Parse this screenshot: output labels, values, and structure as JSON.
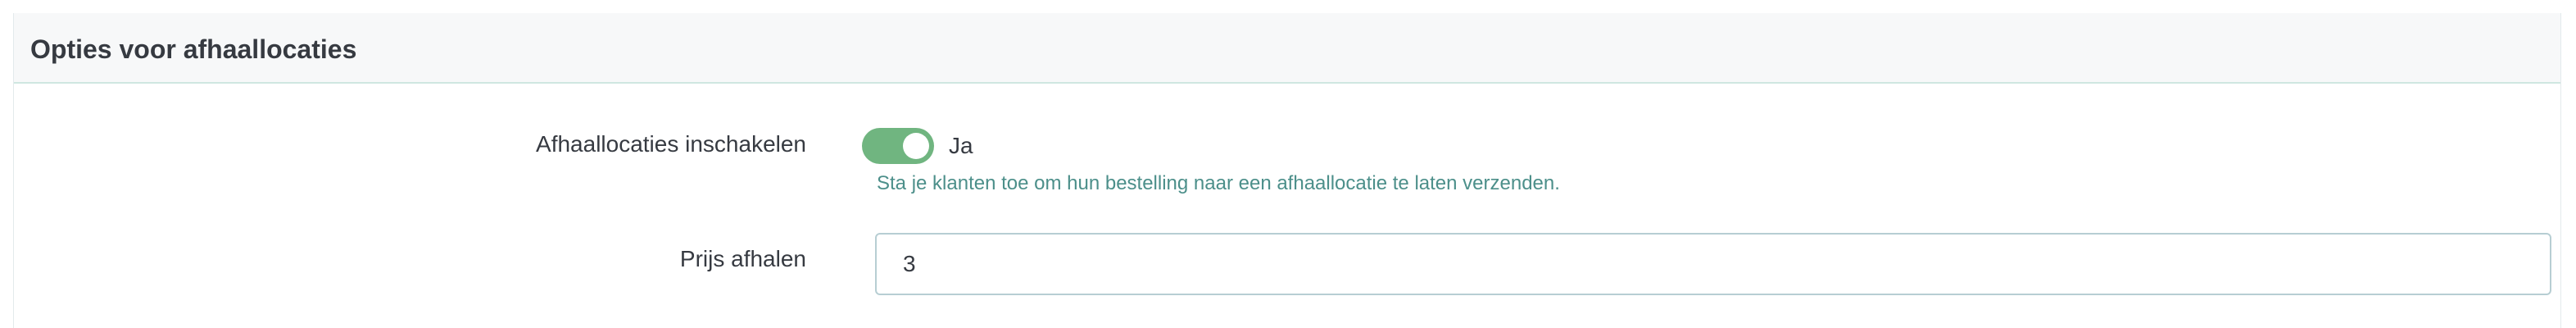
{
  "panel": {
    "title": "Opties voor afhaallocaties"
  },
  "form": {
    "enable_pickup": {
      "label": "Afhaallocaties inschakelen",
      "state": true,
      "state_label": "Ja",
      "help": "Sta je klanten toe om hun bestelling naar een afhaallocatie te laten verzenden."
    },
    "pickup_price": {
      "label": "Prijs afhalen",
      "value": "3"
    }
  },
  "colors": {
    "accent": "#70b580",
    "help_text": "#4c8f8a",
    "header_bg": "#f7f8f9",
    "header_border": "#cfe7e1"
  }
}
